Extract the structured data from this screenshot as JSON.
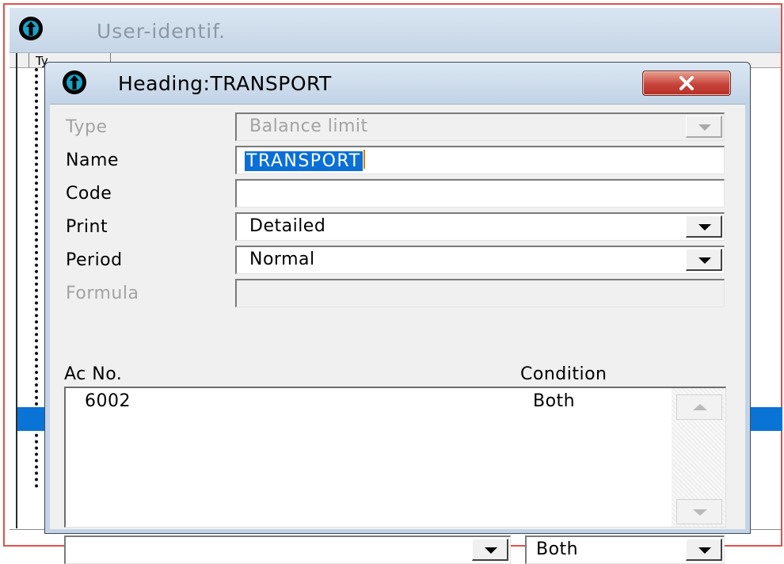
{
  "background_window": {
    "title": "User-identif.",
    "column_header": "Ty"
  },
  "dialog": {
    "title": "Heading:TRANSPORT",
    "close_label": "×",
    "fields": {
      "type": {
        "label": "Type",
        "value": "Balance limit",
        "enabled": false
      },
      "name": {
        "label": "Name",
        "value": "TRANSPORT"
      },
      "code": {
        "label": "Code",
        "value": ""
      },
      "print": {
        "label": "Print",
        "value": "Detailed"
      },
      "period": {
        "label": "Period",
        "value": "Normal"
      },
      "formula": {
        "label": "Formula",
        "value": "",
        "enabled": false
      }
    },
    "list": {
      "columns": [
        "Ac No.",
        "Condition"
      ],
      "rows": [
        {
          "ac_no": "6002",
          "condition": "Both"
        }
      ]
    },
    "bottom": {
      "ac_combo_value": "",
      "condition_combo_value": "Both"
    }
  },
  "colors": {
    "selection_blue": "#0a6fd6",
    "close_red": "#c7443a",
    "titlebar_blue": "#c2d3e6",
    "window_frame_red": "#e2504a"
  }
}
